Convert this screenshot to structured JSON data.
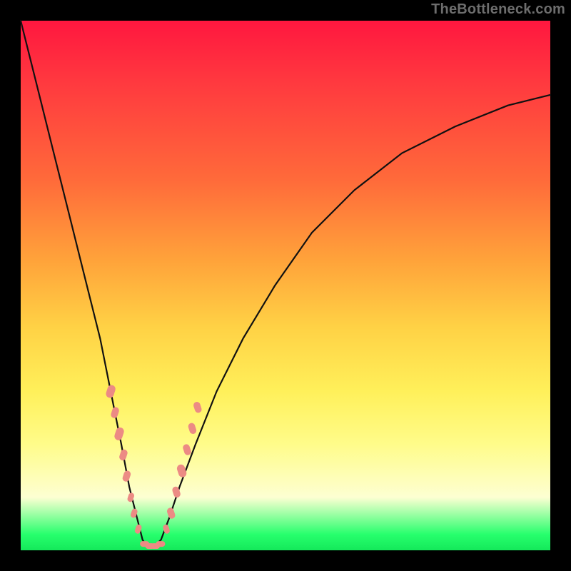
{
  "watermark": "TheBottleneck.com",
  "colors": {
    "background": "#000000",
    "curve": "#111111",
    "marker": "#ec8b84",
    "gradient_stops": [
      "#ff173f",
      "#ff3a3f",
      "#ff6a3a",
      "#ffa23a",
      "#ffd245",
      "#fff05a",
      "#fffc8a",
      "#fdffd2",
      "#27ff6d",
      "#14e85a"
    ]
  },
  "chart_data": {
    "type": "line",
    "title": "",
    "xlabel": "",
    "ylabel": "",
    "xlim": [
      0,
      100
    ],
    "ylim": [
      0,
      100
    ],
    "grid": false,
    "legend": false,
    "series": [
      {
        "name": "bottleneck-curve",
        "x": [
          0,
          3,
          6,
          9,
          12,
          15,
          17,
          19,
          20.5,
          22,
          23,
          24,
          25,
          26.5,
          28,
          30,
          33,
          37,
          42,
          48,
          55,
          63,
          72,
          82,
          92,
          100
        ],
        "y": [
          100,
          88,
          76,
          64,
          52,
          40,
          30,
          20,
          12,
          6,
          2,
          0.5,
          0.5,
          2,
          6,
          12,
          20,
          30,
          40,
          50,
          60,
          68,
          75,
          80,
          84,
          86
        ]
      }
    ],
    "markers": [
      {
        "name": "left-cluster",
        "points": [
          {
            "x": 17.0,
            "y": 30,
            "r": 7
          },
          {
            "x": 17.8,
            "y": 26,
            "r": 6
          },
          {
            "x": 18.6,
            "y": 22,
            "r": 7
          },
          {
            "x": 19.4,
            "y": 18,
            "r": 6
          },
          {
            "x": 20.0,
            "y": 14,
            "r": 6
          },
          {
            "x": 20.8,
            "y": 10,
            "r": 5
          },
          {
            "x": 21.4,
            "y": 7,
            "r": 5
          },
          {
            "x": 22.2,
            "y": 4,
            "r": 5
          }
        ]
      },
      {
        "name": "bottom-cluster",
        "points": [
          {
            "x": 23.4,
            "y": 1.2,
            "r": 5
          },
          {
            "x": 24.4,
            "y": 0.8,
            "r": 5
          },
          {
            "x": 25.4,
            "y": 0.8,
            "r": 5
          },
          {
            "x": 26.4,
            "y": 1.2,
            "r": 5
          }
        ]
      },
      {
        "name": "right-cluster",
        "points": [
          {
            "x": 27.5,
            "y": 4,
            "r": 5
          },
          {
            "x": 28.4,
            "y": 7,
            "r": 6
          },
          {
            "x": 29.4,
            "y": 11,
            "r": 6
          },
          {
            "x": 30.4,
            "y": 15,
            "r": 7
          },
          {
            "x": 31.4,
            "y": 19,
            "r": 6
          },
          {
            "x": 32.4,
            "y": 23,
            "r": 6
          },
          {
            "x": 33.4,
            "y": 27,
            "r": 6
          }
        ]
      }
    ]
  }
}
